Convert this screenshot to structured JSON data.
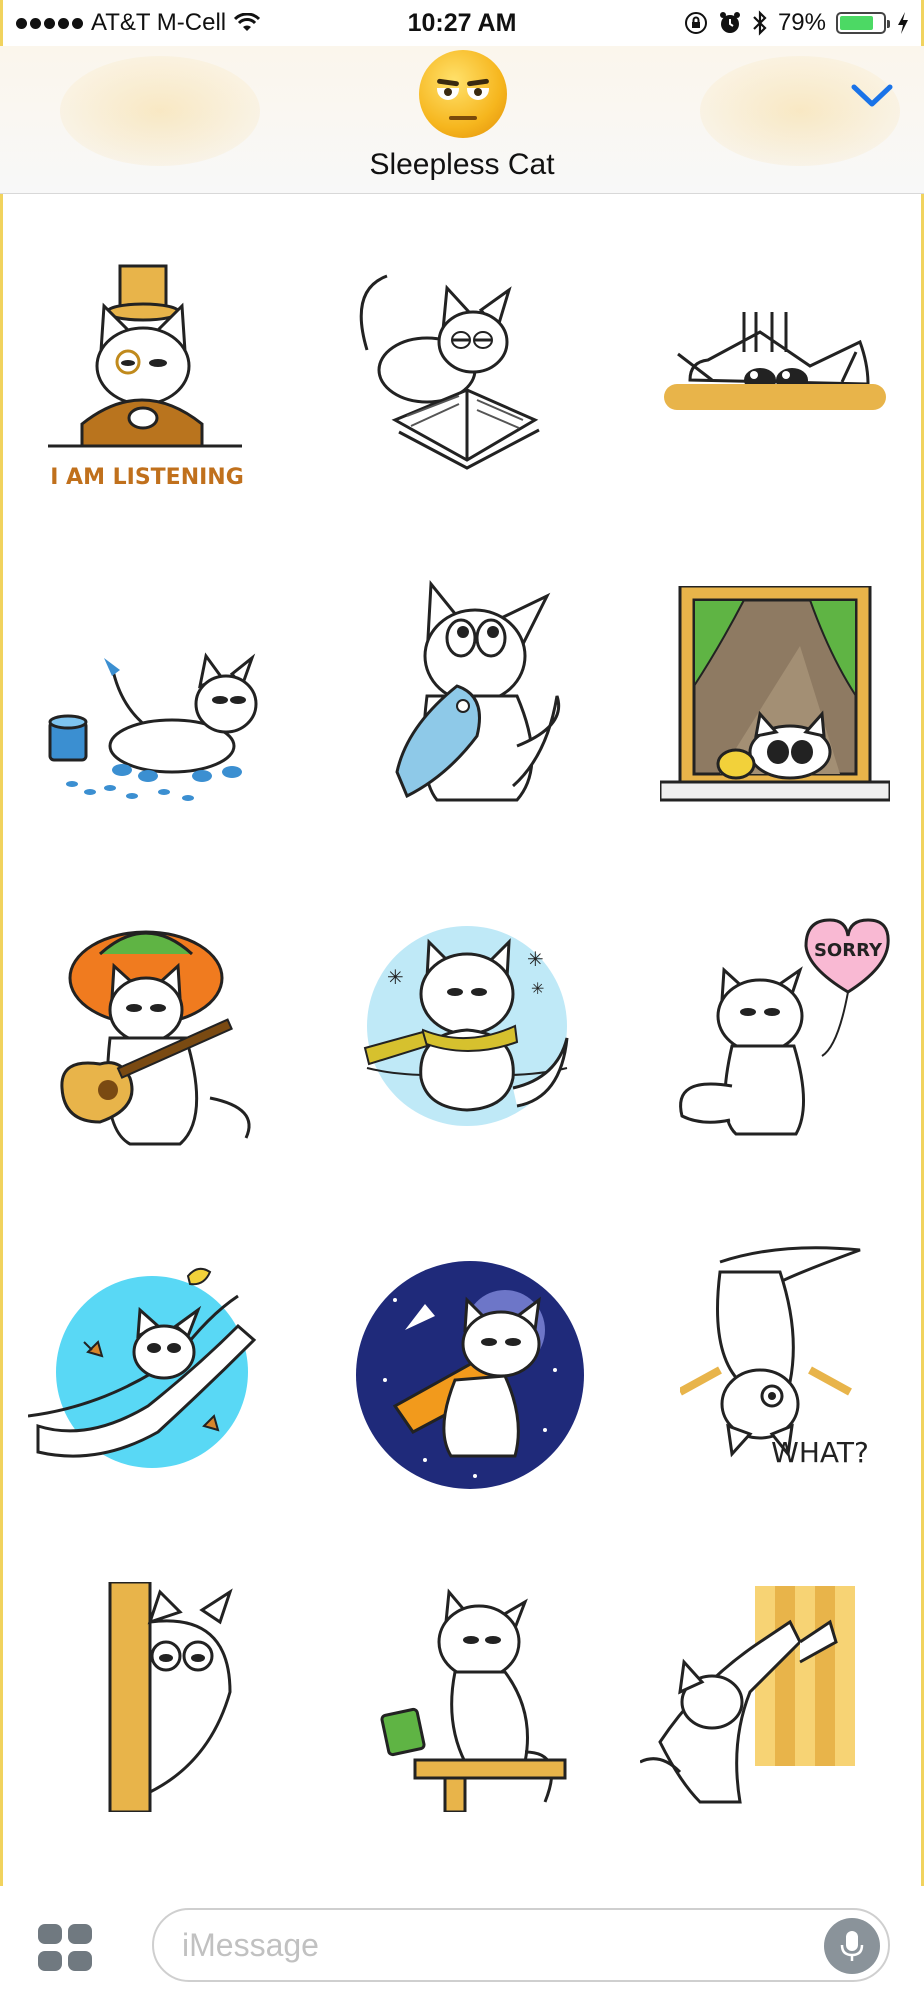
{
  "status_bar": {
    "carrier": "AT&T M-Cell",
    "time": "10:27 AM",
    "battery_percent": "79%",
    "battery_level": 0.79,
    "icons": [
      "signal-dots-icon",
      "wifi-icon",
      "orientation-lock-icon",
      "alarm-icon",
      "bluetooth-icon",
      "battery-icon",
      "charging-bolt-icon"
    ]
  },
  "header": {
    "title": "Sleepless Cat",
    "avatar_icon": "unamused-face-icon",
    "collapse_icon": "chevron-down-icon",
    "accent_color": "#1a73e8"
  },
  "stickers": [
    {
      "name": "sticker-i-am-listening",
      "caption": "I AM LISTENING"
    },
    {
      "name": "sticker-cat-reading-book",
      "caption": ""
    },
    {
      "name": "sticker-cat-peeking-over-edge",
      "caption": ""
    },
    {
      "name": "sticker-cat-paint-paws",
      "caption": ""
    },
    {
      "name": "sticker-cat-holding-fish",
      "caption": ""
    },
    {
      "name": "sticker-cat-window-bird",
      "caption": ""
    },
    {
      "name": "sticker-cat-sombrero-guitar",
      "caption": ""
    },
    {
      "name": "sticker-cat-freezing-scarf",
      "caption": ""
    },
    {
      "name": "sticker-cat-sorry-balloon",
      "caption": "SORRY"
    },
    {
      "name": "sticker-cat-catching-butterfly",
      "caption": ""
    },
    {
      "name": "sticker-cat-astronaut",
      "caption": ""
    },
    {
      "name": "sticker-cat-upside-down-what",
      "caption": "WHAT?"
    },
    {
      "name": "sticker-cat-behind-door",
      "caption": ""
    },
    {
      "name": "sticker-cat-pushing-mug",
      "caption": ""
    },
    {
      "name": "sticker-cat-scratching-wall",
      "caption": ""
    }
  ],
  "bottom_bar": {
    "message_placeholder": "iMessage",
    "apps_icon": "app-drawer-icon",
    "mic_icon": "microphone-icon"
  },
  "colors": {
    "frame_border": "#f1d35e",
    "battery_fill": "#4cd964",
    "sticker_gold": "#e8b44a"
  }
}
